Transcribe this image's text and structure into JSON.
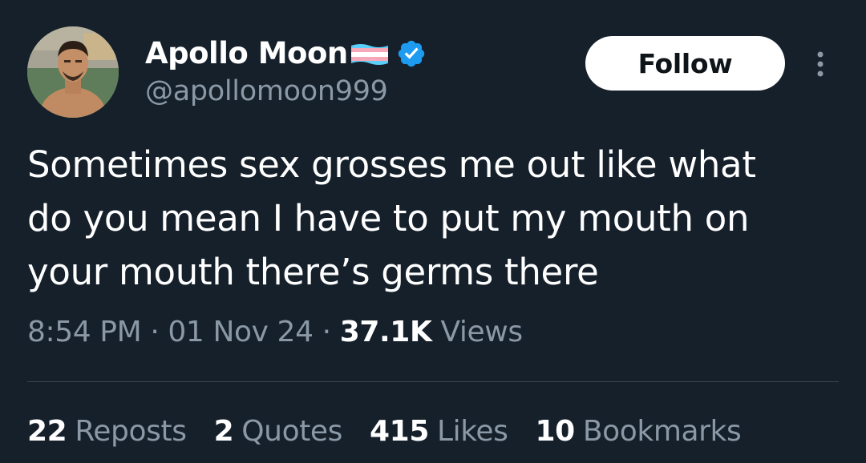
{
  "author": {
    "display_name": "Apollo Moon",
    "handle": "@apollomoon999",
    "flag_icon": "transgender-flag-icon",
    "verified_icon": "verified-badge-icon",
    "verified_color": "#1d9bf0"
  },
  "follow_button": {
    "label": "Follow"
  },
  "tweet": {
    "text_lines": [
      "Sometimes sex grosses me out like what",
      "do you mean I have to put my mouth on",
      "your mouth there’s germs there"
    ]
  },
  "meta": {
    "time": "8:54 PM",
    "separator": "·",
    "date": "01 Nov 24",
    "views_count": "37.1K",
    "views_label": "Views"
  },
  "stats": {
    "reposts": {
      "count": "22",
      "label": "Reposts"
    },
    "quotes": {
      "count": "2",
      "label": "Quotes"
    },
    "likes": {
      "count": "415",
      "label": "Likes"
    },
    "bookmarks": {
      "count": "10",
      "label": "Bookmarks"
    }
  },
  "colors": {
    "background": "#15202b",
    "secondary_text": "#8b98a5",
    "divider": "#38444d",
    "flag_blue": "#5bcefa",
    "flag_pink": "#f5a9b8",
    "flag_white": "#ffffff"
  }
}
